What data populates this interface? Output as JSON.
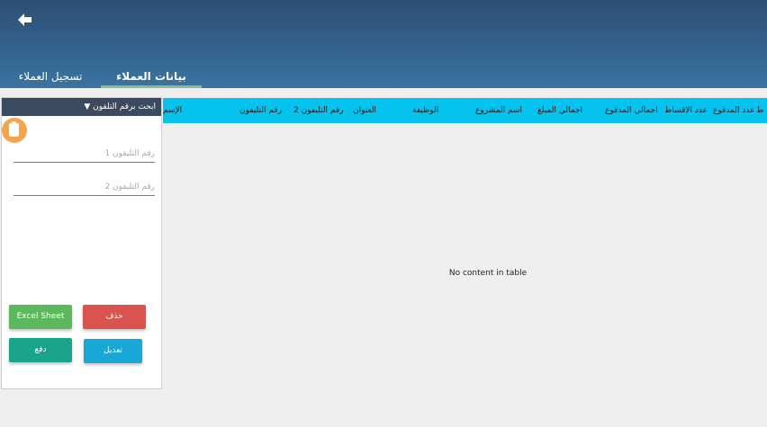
{
  "header": {
    "back_icon": "arrow-left-icon",
    "tabs": [
      {
        "label": "تسجيل العملاء",
        "active": false
      },
      {
        "label": "بيانات العملاء",
        "active": true
      }
    ],
    "colors": {
      "header_top": "#2d5075",
      "header_bottom": "#3a74a1",
      "active_underline": "#8dbb8d"
    }
  },
  "table": {
    "columns": [
      "ط",
      "عدد المدفوع",
      "عدد الاقساط",
      "اجمالي المدفوع",
      "اجمالي المبلغ",
      "اسم المشروع",
      "الوظيفة",
      "العنوان",
      "رقم التليفون 2",
      "رقم التليفون",
      "الإسم"
    ],
    "empty_message": "No content in table",
    "header_color": "#05c2ee"
  },
  "search_panel": {
    "title": "ابحث برقم التلفون ▼",
    "toggle_icon": "clipboard-icon",
    "phone1_placeholder": "رقم التليفون 1",
    "phone2_placeholder": "رقم التليفون 2",
    "buttons": {
      "excel": "Excel Sheet",
      "delete": "حذف",
      "pay": "دفع",
      "edit": "تعديل"
    },
    "colors": {
      "excel": "#5cb85c",
      "delete": "#d9534f",
      "pay": "#1aa48c",
      "edit": "#17a8d8",
      "toggle": "#f4a44a"
    }
  }
}
